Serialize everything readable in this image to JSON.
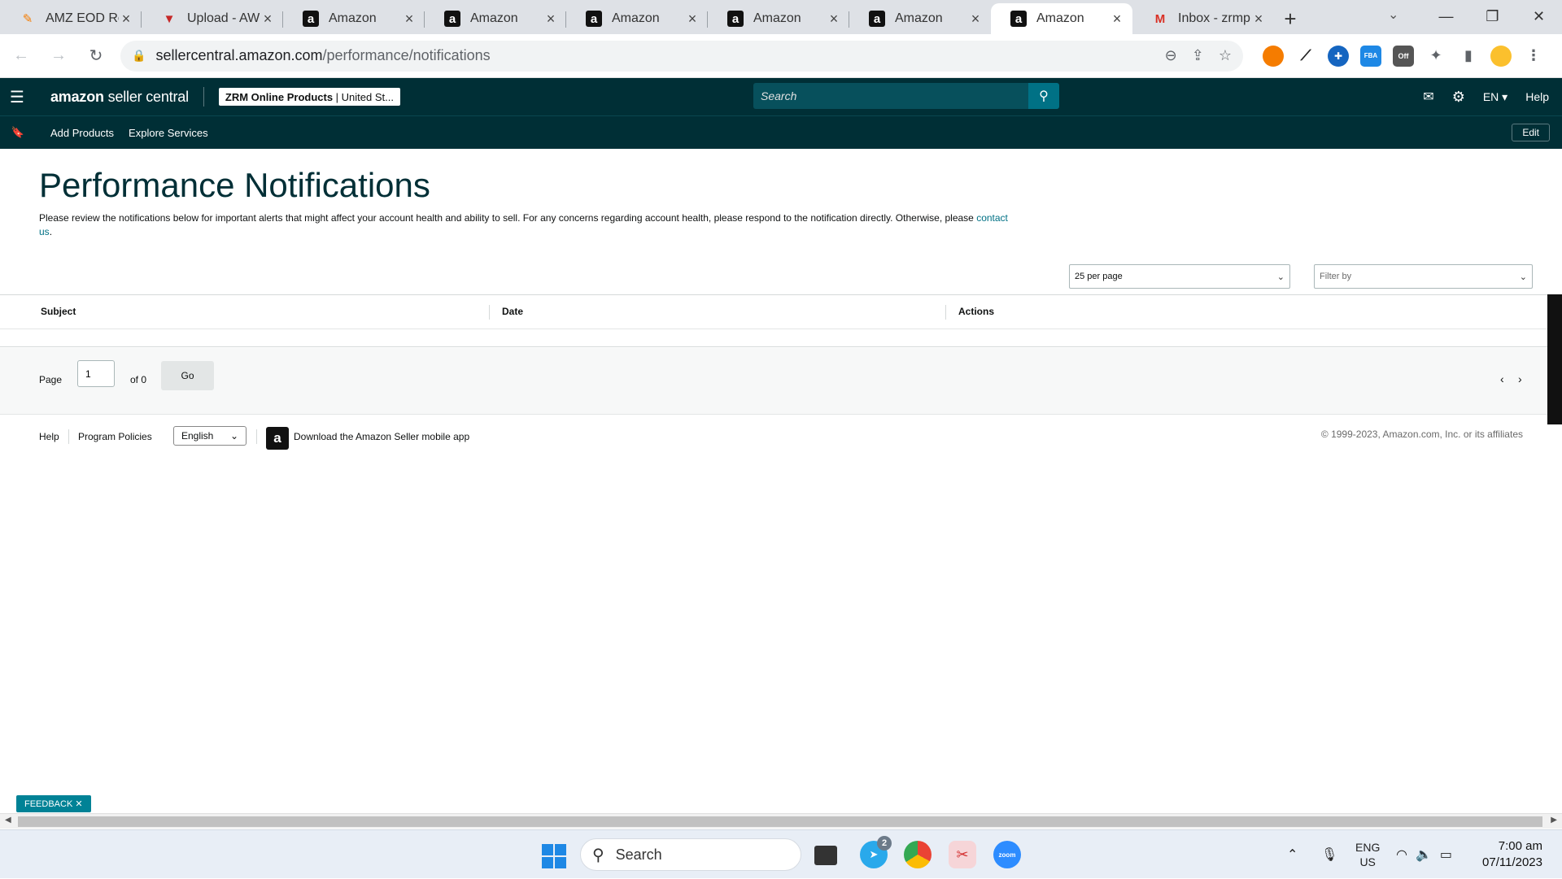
{
  "browser": {
    "tabs": [
      {
        "title": "AMZ EOD Rep",
        "favicon": "eod-icon",
        "active": false
      },
      {
        "title": "Upload - AWI",
        "favicon": "v-icon",
        "active": false
      },
      {
        "title": "Amazon",
        "favicon": "amazon-icon",
        "active": false
      },
      {
        "title": "Amazon",
        "favicon": "amazon-icon",
        "active": false
      },
      {
        "title": "Amazon",
        "favicon": "amazon-icon",
        "active": false
      },
      {
        "title": "Amazon",
        "favicon": "amazon-icon",
        "active": false
      },
      {
        "title": "Amazon",
        "favicon": "amazon-icon",
        "active": false
      },
      {
        "title": "Amazon",
        "favicon": "amazon-icon",
        "active": true
      },
      {
        "title": "Inbox - zrmp",
        "favicon": "gmail-icon",
        "active": false
      }
    ],
    "url_host": "sellercentral.amazon.com",
    "url_path": "/performance/notifications",
    "ext_off_label": "Off",
    "ext_fba_label": "FBA"
  },
  "header": {
    "logo_brand": "amazon",
    "logo_product": "seller central",
    "account_name": "ZRM Online Products",
    "account_region": "United St...",
    "search_placeholder": "Search",
    "language": "EN",
    "help": "Help"
  },
  "subnav": {
    "links": [
      "Add Products",
      "Explore Services"
    ],
    "edit": "Edit"
  },
  "page": {
    "title": "Performance Notifications",
    "description": "Please review the notifications below for important alerts that might affect your account health and ability to sell. For any concerns regarding account health, please respond to the notification directly. Otherwise, please",
    "contact_link": "contact us",
    "per_page": "25 per page",
    "filter_placeholder": "Filter by",
    "columns": [
      "Subject",
      "Date",
      "Actions"
    ],
    "pager": {
      "page_label": "Page",
      "page_value": "1",
      "of_label": "of 0",
      "go": "Go"
    }
  },
  "footer": {
    "help": "Help",
    "policies": "Program Policies",
    "language": "English",
    "app_text": "Download the Amazon Seller mobile app",
    "copyright": "© 1999-2023, Amazon.com, Inc. or its affiliates",
    "feedback": "FEEDBACK"
  },
  "taskbar": {
    "search": "Search",
    "telegram_badge": "2",
    "zoom_label": "zoom",
    "lang_top": "ENG",
    "lang_bottom": "US",
    "time": "7:00 am",
    "date": "07/11/2023"
  },
  "colors": {
    "header_bg": "#002f36",
    "search_btn": "#007185",
    "link": "#007185",
    "title": "#002f36",
    "feedback": "#008296"
  }
}
